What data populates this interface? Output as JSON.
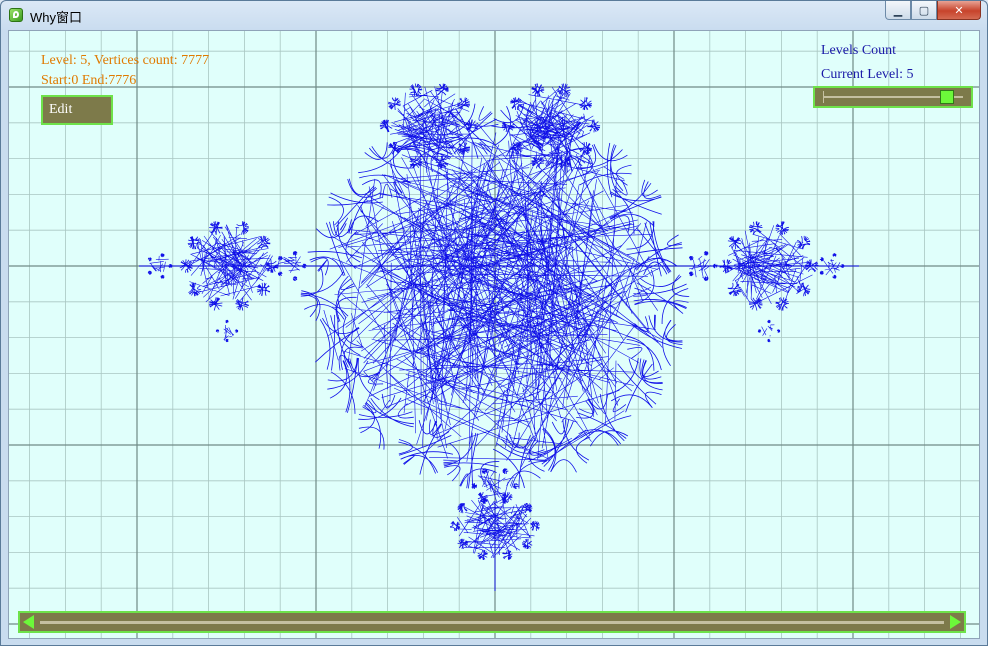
{
  "window": {
    "title": "Why窗口",
    "controls": {
      "minimize": "▁",
      "maximize": "▢",
      "close": "✕"
    }
  },
  "info": {
    "level_line": "Level: 5, Vertices count: 7777",
    "range_line": "Start:0 End:7776",
    "edit_label": "Edit"
  },
  "levels": {
    "count_label": "Levels Count",
    "current_label": "Current Level: 5",
    "slider_value": 0.93
  },
  "scrollbar": {
    "left_arrow": "left-arrow-icon",
    "right_arrow": "right-arrow-icon"
  },
  "colors": {
    "background": "#e0fffb",
    "fractal": "#1010e8",
    "grid_major": "#6f8a86",
    "grid_minor": "#a9c6c2",
    "accent": "#6ee24a",
    "info_text": "#e07a00",
    "level_text": "#1a1aa8"
  }
}
